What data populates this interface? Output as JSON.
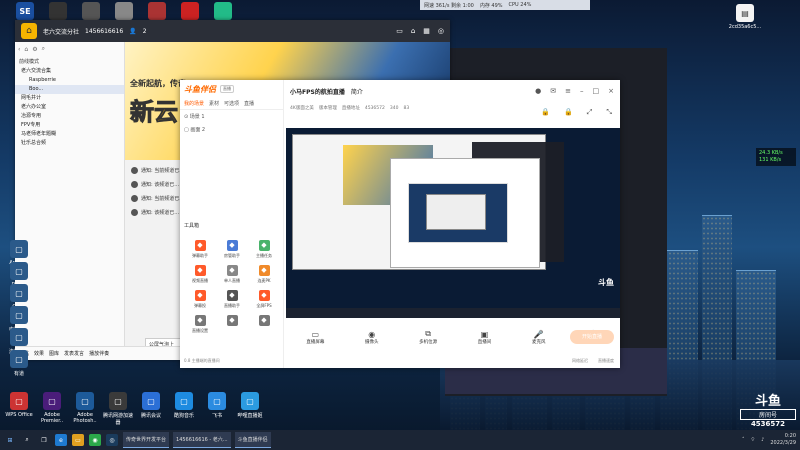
{
  "topbar": {
    "net": "网速 361/s 剩余 1:00",
    "ram": "内存 49%",
    "cpu": "CPU 24%",
    "speed_up": "24.3 KB/s",
    "speed_down": "131 KB/s"
  },
  "desktop_icons": [
    {
      "label": "SE",
      "color": "#1a4fa0"
    },
    {
      "label": "",
      "color": "#333"
    },
    {
      "label": "",
      "color": "#555"
    },
    {
      "label": "",
      "color": "#888"
    },
    {
      "label": "",
      "color": "#a33"
    },
    {
      "label": "",
      "color": "#c22"
    },
    {
      "label": "",
      "color": "#2b8"
    }
  ],
  "right_desktop_icon": {
    "label": "2cd35a6c5..."
  },
  "chat_window": {
    "title": "老六交流分社",
    "id": "1456616616",
    "members": "2",
    "sidebar_mode": "前线模式",
    "tree": [
      {
        "label": "老六交流合集",
        "sub": false,
        "sel": false
      },
      {
        "label": "Raspberrie",
        "sub": true,
        "sel": false
      },
      {
        "label": "Boo...",
        "sub": true,
        "sel": true
      },
      {
        "label": "网毛井计",
        "sub": false,
        "sel": false
      },
      {
        "label": "老六办公室",
        "sub": false,
        "sel": false
      },
      {
        "label": "冶源专用",
        "sub": false,
        "sel": false
      },
      {
        "label": "FPV专用",
        "sub": false,
        "sel": false
      },
      {
        "label": "马老师老年题糊",
        "sub": false,
        "sel": false
      },
      {
        "label": "钍乐总合频",
        "sub": false,
        "sel": false
      }
    ],
    "banner_small": "全新起航，传奇",
    "banner_big": "新云",
    "notices": [
      "通知: 当前频道已...",
      "通知: 该频道已...",
      "通知: 当前频道已...",
      "通知: 该频道已..."
    ],
    "input_box": "公屏气泡上",
    "bottom_items": [
      "剪贴",
      "效果",
      "图库",
      "发表发言",
      "播放伴奏"
    ]
  },
  "douyu": {
    "brand": "斗鱼伴侣",
    "ver": "直播",
    "tabs": [
      "我的场景",
      "素材",
      "可选项",
      "直播"
    ],
    "scene_label": "场景 1",
    "scene2": "画面 2",
    "tools_title": "工具箱",
    "tools": [
      {
        "label": "弹幕助手",
        "color": "#ff5a2a"
      },
      {
        "label": "房管助手",
        "color": "#4a7bd6"
      },
      {
        "label": "主播任务",
        "color": "#4ab36b"
      },
      {
        "label": "视频直播",
        "color": "#ff5a2a"
      },
      {
        "label": "单人直播",
        "color": "#888"
      },
      {
        "label": "连麦PK",
        "color": "#f08a2a"
      },
      {
        "label": "弹幕投",
        "color": "#ff5a2a"
      },
      {
        "label": "直播助手",
        "color": "#555"
      },
      {
        "label": "全屏FPS",
        "color": "#ff5a2a"
      },
      {
        "label": "直播设置",
        "color": "#777"
      },
      {
        "label": "",
        "color": "#777"
      },
      {
        "label": "",
        "color": "#777"
      }
    ],
    "footer": "0.8 主播端的直播间",
    "room_title": "小马FPS的航拍直播",
    "room_tag": "简介",
    "sub": [
      "4K版面之美",
      "版本管理",
      "直播地址",
      "4536572",
      "340",
      "83"
    ],
    "bottom_buttons": [
      "直播屏幕",
      "摄像头",
      "多机位源",
      "直播间",
      "麦克风",
      "扬声器"
    ],
    "start_btn": "开始直播",
    "foot_links": [
      "网络延迟",
      "直播速度"
    ]
  },
  "big_logo": {
    "a": "斗鱼",
    "b": "房间号",
    "c": "4536572"
  },
  "left_desktop": [
    "Arduino",
    "Direct",
    "Gimp",
    "电脑卫士",
    "连接手机",
    "有道"
  ],
  "bottom_desktop": [
    {
      "label": "WPS Office",
      "color": "#c33"
    },
    {
      "label": "Adobe Premier..",
      "color": "#4a1d7a"
    },
    {
      "label": "Adobe Photosh..",
      "color": "#1d5a9a"
    },
    {
      "label": "腾讯网游加速器",
      "color": "#3a3a3a"
    },
    {
      "label": "腾讯会议",
      "color": "#2b6fd6"
    },
    {
      "label": "酷狗音乐",
      "color": "#1e8be0"
    },
    {
      "label": "飞书",
      "color": "#2b8be0"
    },
    {
      "label": "哔哩直播姬",
      "color": "#2b9be0"
    }
  ],
  "taskbar": {
    "apps": [
      "传奇世界开发平台",
      "1456616616 - 老六...",
      "斗鱼直播伴侣"
    ],
    "time": "0:20",
    "date": "2022/3/29"
  }
}
